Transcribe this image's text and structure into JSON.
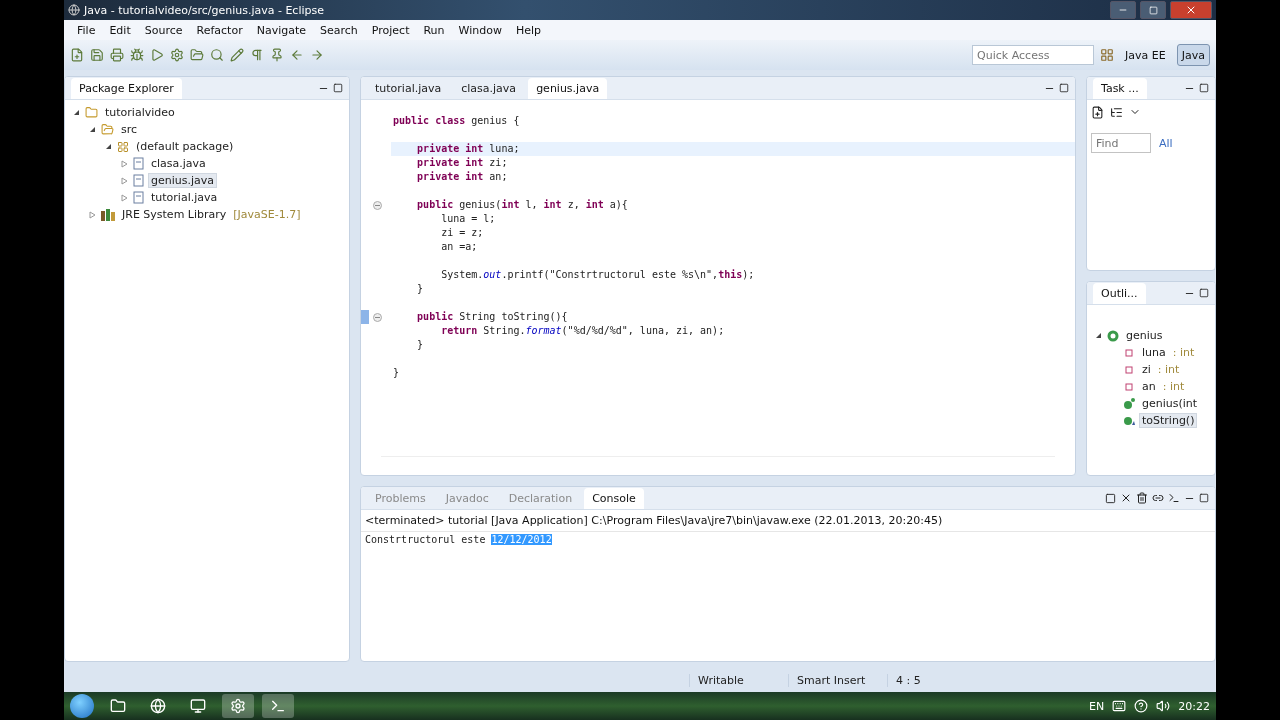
{
  "window": {
    "title": "Java - tutorialvideo/src/genius.java - Eclipse"
  },
  "menu": [
    "File",
    "Edit",
    "Source",
    "Refactor",
    "Navigate",
    "Search",
    "Project",
    "Run",
    "Window",
    "Help"
  ],
  "toolbar": {
    "quick_access": {
      "placeholder": "Quick Access"
    },
    "perspectives": [
      {
        "label": "Java EE",
        "selected": false
      },
      {
        "label": "Java",
        "selected": true
      }
    ]
  },
  "package_explorer": {
    "title": "Package Explorer",
    "tree": [
      {
        "label": "tutorialvideo",
        "kind": "project",
        "expanded": true,
        "selected": false,
        "children": [
          {
            "label": "src",
            "kind": "source",
            "expanded": true,
            "selected": false,
            "children": [
              {
                "label": "(default package)",
                "kind": "package",
                "expanded": true,
                "selected": false,
                "children": [
                  {
                    "label": "clasa.java",
                    "kind": "file",
                    "expanded": false,
                    "selected": false
                  },
                  {
                    "label": "genius.java",
                    "kind": "file",
                    "expanded": false,
                    "selected": true
                  },
                  {
                    "label": "tutorial.java",
                    "kind": "file",
                    "expanded": false,
                    "selected": false
                  }
                ]
              }
            ]
          },
          {
            "label": "JRE System Library",
            "suffix": "[JavaSE-1.7]",
            "kind": "library",
            "expanded": false,
            "selected": false
          }
        ]
      }
    ]
  },
  "editor": {
    "tabs": [
      {
        "label": "tutorial.java",
        "selected": false
      },
      {
        "label": "clasa.java",
        "selected": false
      },
      {
        "label": "genius.java",
        "selected": true
      }
    ],
    "lines": [
      {
        "kind": "code",
        "text": "**public class** genius {",
        "current": false,
        "fold": false,
        "mark": false
      },
      {
        "kind": "blank",
        "current": false,
        "fold": false,
        "mark": false
      },
      {
        "kind": "code",
        "text": "    **private int** luna;",
        "current": true,
        "fold": false,
        "mark": false
      },
      {
        "kind": "code",
        "text": "    **private int** zi;",
        "current": false,
        "fold": false,
        "mark": false
      },
      {
        "kind": "code",
        "text": "    **private int** an;",
        "current": false,
        "fold": false,
        "mark": false
      },
      {
        "kind": "blank",
        "current": false,
        "fold": false,
        "mark": false
      },
      {
        "kind": "code",
        "text": "    **public** genius(**int** l, **int** z, **int** a){",
        "current": false,
        "fold": true,
        "mark": false
      },
      {
        "kind": "code",
        "text": "        luna = l;",
        "current": false,
        "fold": false,
        "mark": false
      },
      {
        "kind": "code",
        "text": "        zi = z;",
        "current": false,
        "fold": false,
        "mark": false
      },
      {
        "kind": "code",
        "text": "        an =a;",
        "current": false,
        "fold": false,
        "mark": false
      },
      {
        "kind": "blank",
        "current": false,
        "fold": false,
        "mark": false
      },
      {
        "kind": "code",
        "text": "        System.*out*.printf(\"Constrtructorul este %s\\n\",**this**);",
        "current": false,
        "fold": false,
        "mark": false
      },
      {
        "kind": "code",
        "text": "    }",
        "current": false,
        "fold": false,
        "mark": false
      },
      {
        "kind": "blank",
        "current": false,
        "fold": false,
        "mark": false
      },
      {
        "kind": "code",
        "text": "    **public** String toString(){",
        "current": false,
        "fold": true,
        "mark": true
      },
      {
        "kind": "code",
        "text": "        **return** String.*format*(\"%d/%d/%d\", luna, zi, an);",
        "current": false,
        "fold": false,
        "mark": false
      },
      {
        "kind": "code",
        "text": "    }",
        "current": false,
        "fold": false,
        "mark": false
      },
      {
        "kind": "blank",
        "current": false,
        "fold": false,
        "mark": false
      },
      {
        "kind": "code",
        "text": "}",
        "current": false,
        "fold": false,
        "mark": false
      }
    ]
  },
  "task_list": {
    "title": "Task ...",
    "find": {
      "placeholder": "Find"
    },
    "filter": "All"
  },
  "outline": {
    "title": "Outli...",
    "tree": [
      {
        "label": "genius",
        "kind": "class",
        "expanded": true,
        "selected": false,
        "children": [
          {
            "label": "luna",
            "type": ": int",
            "kind": "field",
            "selected": false
          },
          {
            "label": "zi",
            "type": ": int",
            "kind": "field",
            "selected": false
          },
          {
            "label": "an",
            "type": ": int",
            "kind": "field",
            "selected": false
          },
          {
            "label": "genius(int",
            "kind": "constructor",
            "selected": false
          },
          {
            "label": "toString()",
            "kind": "method",
            "selected": true
          }
        ]
      }
    ]
  },
  "console": {
    "tabs": [
      {
        "label": "Problems",
        "selected": false
      },
      {
        "label": "Javadoc",
        "selected": false
      },
      {
        "label": "Declaration",
        "selected": false
      },
      {
        "label": "Console",
        "selected": true
      }
    ],
    "header": "<terminated> tutorial [Java Application] C:\\Program Files\\Java\\jre7\\bin\\javaw.exe (22.01.2013, 20:20:45)",
    "output": "Constrtructorul este",
    "selection": "12/12/2012"
  },
  "status_bar": [
    "Writable",
    "Smart Insert",
    "4 : 5"
  ],
  "taskbar": {
    "language": "EN",
    "time": "20:22"
  }
}
